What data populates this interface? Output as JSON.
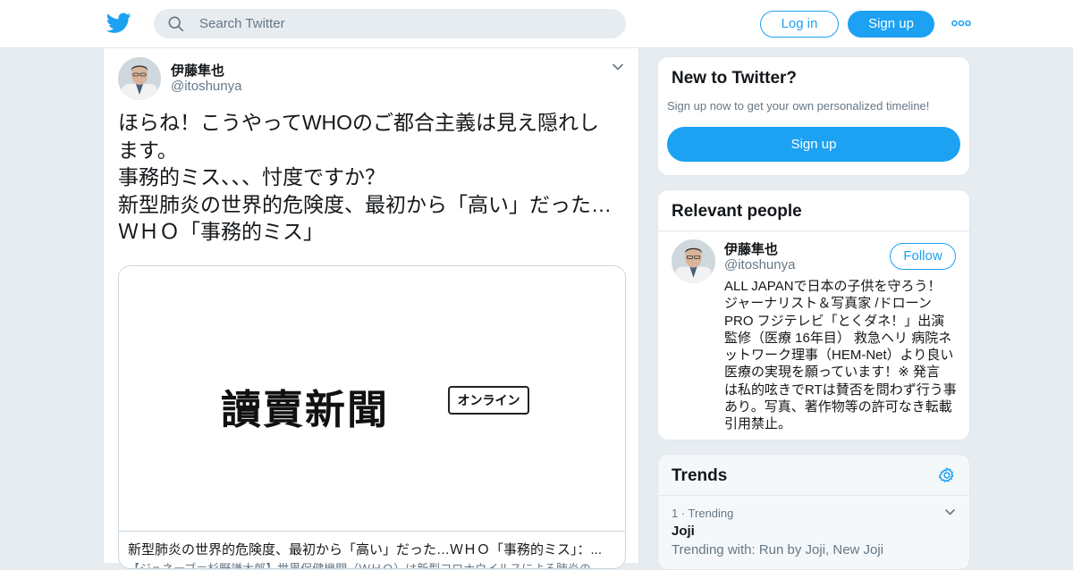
{
  "colors": {
    "accent": "#1da1f2",
    "background": "#e6ecf0",
    "muted": "#657786"
  },
  "topbar": {
    "logo_icon": "twitter-bird-icon",
    "search_placeholder": "Search Twitter",
    "login_label": "Log in",
    "signup_label": "Sign up",
    "more_icon": "more-dots-icon"
  },
  "tweet": {
    "author_name": "伊藤隼也",
    "author_handle": "@itoshunya",
    "text_lines": [
      "ほらね！こうやってWHOのご都合主義は見え隠れし",
      "ます。",
      "事務的ミス、、、忖度ですか？",
      "新型肺炎の世界的危険度、最初から「高い」だった…",
      "ＷＨＯ「事務的ミス」"
    ],
    "card": {
      "masthead": "讀賣新聞",
      "masthead_badge": "オンライン",
      "title": "新型肺炎の世界的危険度、最初から「高い」だった…ＷＨＯ「事務的ミス」：...",
      "description": "【ジュネーブ＝杉野謙太郎】世界保健機関（ＷＨＯ）は新型コロナウイルスによる肺炎の"
    }
  },
  "new_to_twitter": {
    "heading": "New to Twitter?",
    "subtext": "Sign up now to get your own personalized timeline!",
    "button_label": "Sign up"
  },
  "relevant_people": {
    "heading": "Relevant people",
    "person": {
      "name": "伊藤隼也",
      "handle": "@itoshunya",
      "follow_label": "Follow",
      "bio_lines": [
        "ALL JAPANで日本の子供を守ろう！",
        "ジャーナリスト＆写真家 /ドローン",
        "PRO フジテレビ「とくダネ！」出演",
        "監修（医療 16年目） 救急ヘリ 病院ネ",
        "ットワーク理事（HEM-Net）より良い",
        "医療の実現を願っています！※ 発言",
        "は私的呟きでRTは賛否を問わず行う事",
        "あり。写真、著作物等の許可なき転載",
        "引用禁止。"
      ]
    }
  },
  "trends": {
    "heading": "Trends",
    "items": [
      {
        "meta": "1 · Trending",
        "name": "Joji",
        "with": "Trending with: Run by Joji, New Joji"
      }
    ]
  }
}
